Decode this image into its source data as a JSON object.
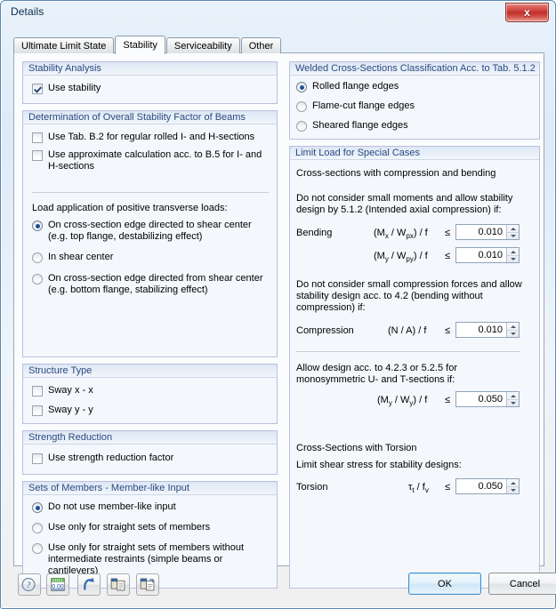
{
  "window": {
    "title": "Details",
    "close_label": "x"
  },
  "tabs": [
    {
      "label": "Ultimate Limit State",
      "active": false
    },
    {
      "label": "Stability",
      "active": true
    },
    {
      "label": "Serviceability",
      "active": false
    },
    {
      "label": "Other",
      "active": false
    }
  ],
  "left": {
    "stability_analysis": {
      "title": "Stability Analysis",
      "use_stability": {
        "label": "Use stability",
        "checked": true
      }
    },
    "overall_factor": {
      "title": "Determination of Overall Stability Factor of Beams",
      "use_tab_b2": {
        "label": "Use Tab. B.2 for regular rolled I- and H-sections",
        "checked": false
      },
      "use_approx_b5": {
        "label": "Use approximate calculation acc. to B.5 for I- and H-sections",
        "checked": false
      },
      "load_application_label": "Load application of positive transverse loads:",
      "load_options": [
        {
          "label": "On cross-section edge directed to shear center (e.g. top flange, destabilizing effect)",
          "line1": "On cross-section edge directed to shear center",
          "line2": "(e.g. top flange, destabilizing effect)",
          "selected": true
        },
        {
          "label": "In shear center",
          "line1": "In shear center",
          "line2": "",
          "selected": false
        },
        {
          "label": "On cross-section edge directed from shear center (e.g. bottom flange, stabilizing effect)",
          "line1": "On cross-section edge directed from shear center",
          "line2": "(e.g. bottom flange, stabilizing effect)",
          "selected": false
        }
      ]
    },
    "structure_type": {
      "title": "Structure Type",
      "sway_x": {
        "label": "Sway x - x",
        "checked": false
      },
      "sway_y": {
        "label": "Sway y - y",
        "checked": false
      }
    },
    "strength_reduction": {
      "title": "Strength Reduction",
      "use_factor": {
        "label": "Use strength reduction factor",
        "checked": false
      }
    },
    "sets_of_members": {
      "title": "Sets of Members - Member-like Input",
      "options": [
        {
          "line1": "Do not use member-like input",
          "line2": "",
          "selected": true
        },
        {
          "line1": "Use only for straight sets of members",
          "line2": "",
          "selected": false
        },
        {
          "line1": "Use only for straight sets of members without",
          "line2": "intermediate restraints (simple beams or cantilevers)",
          "selected": false
        }
      ]
    }
  },
  "right": {
    "welded_classification": {
      "title": "Welded Cross-Sections Classification Acc. to Tab. 5.1.2",
      "options": [
        {
          "label": "Rolled flange edges",
          "selected": true
        },
        {
          "label": "Flame-cut flange edges",
          "selected": false
        },
        {
          "label": "Sheared flange edges",
          "selected": false
        }
      ]
    },
    "limit_load": {
      "title": "Limit Load for Special Cases",
      "text_compression_bending": "Cross-sections with compression and bending",
      "note_moments_line1": "Do not consider small moments and allow stability",
      "note_moments_line2": "design by 5.1.2 (Intended axial compression) if:",
      "bending_label": "Bending",
      "bending_x": {
        "formula_pre": "(M",
        "formula_sub1": "x",
        "formula_mid": " / W",
        "formula_sub2": "px",
        "formula_post": ") / f",
        "operator": "≤",
        "value": "0.010"
      },
      "bending_y": {
        "formula_pre": "(M",
        "formula_sub1": "y",
        "formula_mid": " / W",
        "formula_sub2": "py",
        "formula_post": ") / f",
        "operator": "≤",
        "value": "0.010"
      },
      "note_compression_line1": "Do not consider small compression forces and allow",
      "note_compression_line2": "stability design acc. to 4.2 (bending without",
      "note_compression_line3": "compression) if:",
      "compression_label": "Compression",
      "compression": {
        "formula_pre": "(N / A) / f",
        "operator": "≤",
        "value": "0.010"
      },
      "note_mono_line1": "Allow design acc. to 4.2.3 or 5.2.5 for",
      "note_mono_line2": "monosymmetric U- and T-sections if:",
      "mono_y": {
        "formula_pre": "(M",
        "formula_sub1": "y",
        "formula_mid": " / W",
        "formula_sub2": "y",
        "formula_post": ") / f",
        "operator": "≤",
        "value": "0.050"
      },
      "torsion_heading": "Cross-Sections with Torsion",
      "torsion_note": "Limit shear stress for stability designs:",
      "torsion_label": "Torsion",
      "torsion": {
        "formula_pre": "τ",
        "formula_sub1": "t",
        "formula_mid": " / f",
        "formula_sub2": "v",
        "formula_post": "",
        "operator": "≤",
        "value": "0.050"
      }
    }
  },
  "bottom": {
    "tools": [
      {
        "name": "help-icon",
        "title": "Help"
      },
      {
        "name": "units-icon",
        "title": "Units and decimal places",
        "caption": "0.00"
      },
      {
        "name": "undo-icon",
        "title": "Restore default settings"
      },
      {
        "name": "copy-icon",
        "title": "Copy"
      },
      {
        "name": "paste-icon",
        "title": "Paste"
      }
    ],
    "ok_label": "OK",
    "cancel_label": "Cancel"
  },
  "colors": {
    "accent": "#1d4f93",
    "group_header_text": "#2a4a80",
    "close_red": "#c32f2a",
    "default_button_border": "#3c8fd4"
  }
}
